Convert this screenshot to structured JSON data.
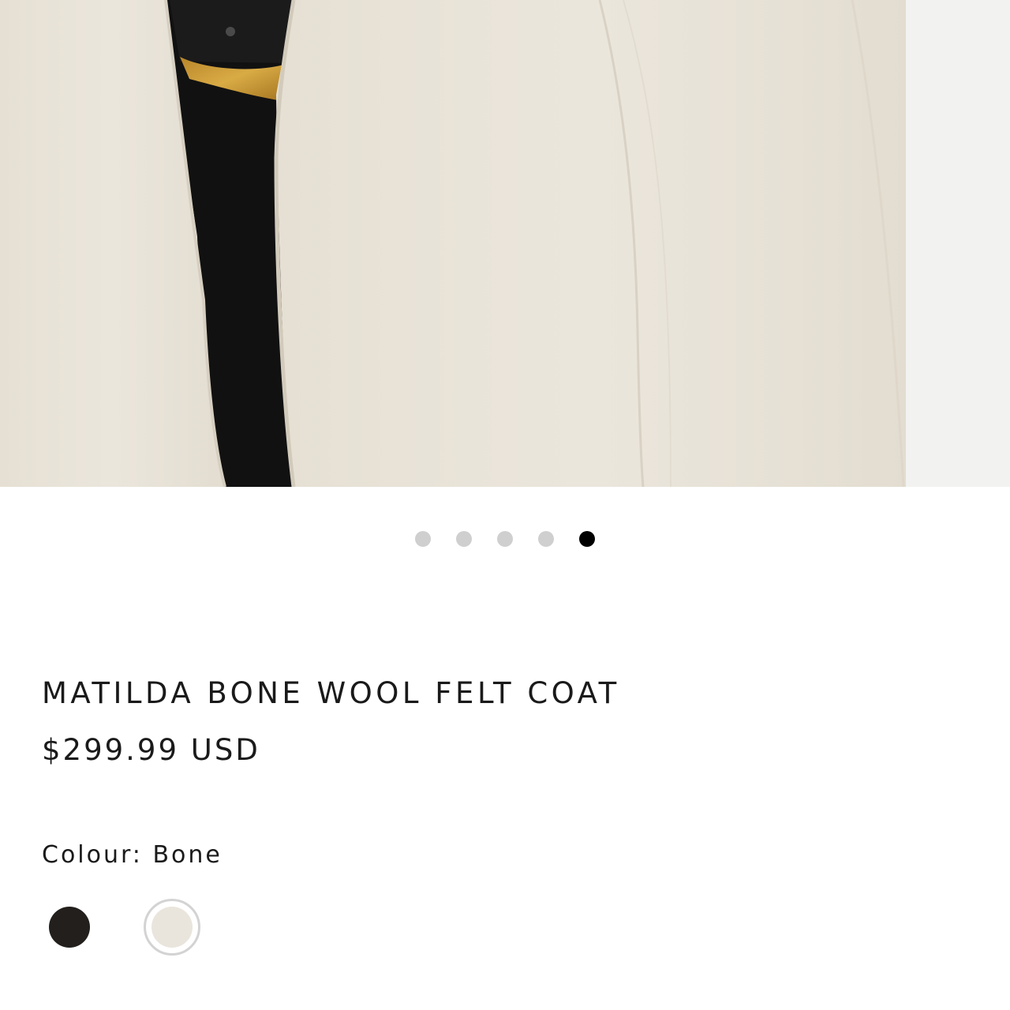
{
  "product": {
    "title": "MATILDA BONE WOOL FELT COAT",
    "price": "$299.99 USD"
  },
  "gallery": {
    "image_subject": "coat-closeup-image",
    "slide_count": 5,
    "active_slide": 5
  },
  "colour": {
    "label": "Colour: Bone",
    "options": [
      {
        "name": "Black",
        "hex": "#221f1d",
        "selected": false
      },
      {
        "name": "Bone",
        "hex": "#eae5dc",
        "selected": true
      }
    ]
  },
  "colors": {
    "dot_inactive": "#cfcfcf",
    "dot_active": "#000000",
    "coat": "#eae5da",
    "belt_buckle": "#c9992f",
    "text": "#1a1a1a"
  }
}
